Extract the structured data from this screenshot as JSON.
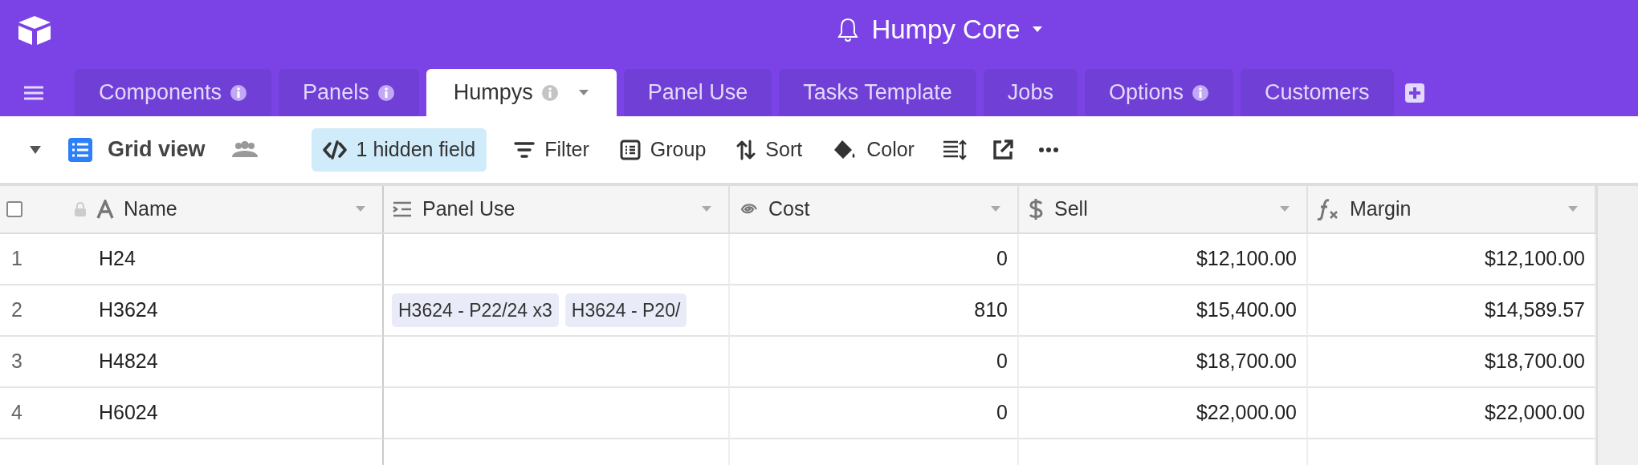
{
  "base": {
    "title": "Humpy Core"
  },
  "tabs": [
    {
      "label": "Components",
      "info": true,
      "selected": false
    },
    {
      "label": "Panels",
      "info": true,
      "selected": false
    },
    {
      "label": "Humpys",
      "info": true,
      "selected": true
    },
    {
      "label": "Panel Use",
      "info": false,
      "selected": false
    },
    {
      "label": "Tasks Template",
      "info": false,
      "selected": false
    },
    {
      "label": "Jobs",
      "info": false,
      "selected": false
    },
    {
      "label": "Options",
      "info": true,
      "selected": false
    },
    {
      "label": "Customers",
      "info": false,
      "selected": false
    }
  ],
  "toolbar": {
    "view_name": "Grid view",
    "items": [
      {
        "kind": "hide",
        "label": "1 hidden field",
        "highlighted": true
      },
      {
        "kind": "filter",
        "label": "Filter",
        "highlighted": false
      },
      {
        "kind": "group",
        "label": "Group",
        "highlighted": false
      },
      {
        "kind": "sort",
        "label": "Sort",
        "highlighted": false
      },
      {
        "kind": "color",
        "label": "Color",
        "highlighted": false
      },
      {
        "kind": "row-height"
      },
      {
        "kind": "share"
      },
      {
        "kind": "more"
      }
    ]
  },
  "table": {
    "select_all": {
      "checked": false
    },
    "columns": [
      {
        "label": "Name",
        "kind": "text"
      },
      {
        "label": "Panel Use",
        "kind": "link"
      },
      {
        "label": "Cost",
        "kind": "rollup"
      },
      {
        "label": "Sell",
        "kind": "currency"
      },
      {
        "label": "Margin",
        "kind": "formula"
      }
    ],
    "rows": [
      {
        "number": "1",
        "cells": [
          "H24",
          null,
          "0",
          "$12,100.00",
          "$12,100.00"
        ]
      },
      {
        "number": "2",
        "cells": [
          "H3624",
          [
            "H3624 - P22/24 x3",
            "H3624 - P20/"
          ],
          "810",
          "$15,400.00",
          "$14,589.57"
        ]
      },
      {
        "number": "3",
        "cells": [
          "H4824",
          null,
          "0",
          "$18,700.00",
          "$18,700.00"
        ]
      },
      {
        "number": "4",
        "cells": [
          "H6024",
          null,
          "0",
          "$22,000.00",
          "$22,000.00"
        ]
      }
    ]
  }
}
